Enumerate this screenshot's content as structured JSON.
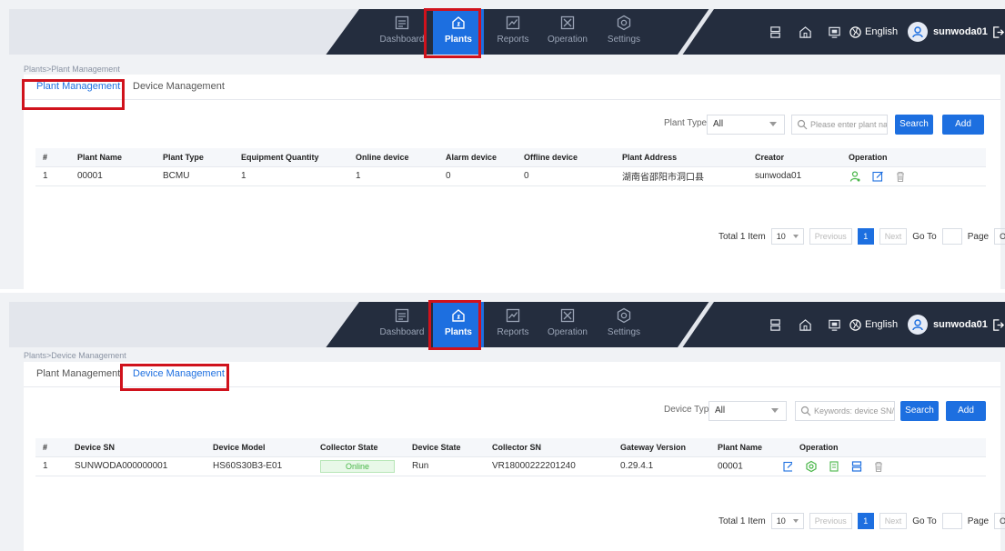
{
  "nav": {
    "items": [
      {
        "label": "Dashboard",
        "icon": "dashboard-icon"
      },
      {
        "label": "Plants",
        "icon": "plants-home-icon"
      },
      {
        "label": "Reports",
        "icon": "reports-icon"
      },
      {
        "label": "Operation",
        "icon": "operation-icon"
      },
      {
        "label": "Settings",
        "icon": "settings-icon"
      }
    ],
    "active_item": "Plants",
    "language": "English",
    "username": "sunwoda01",
    "accent_color": "#1d6fe0",
    "highlight_color": "#d0121c"
  },
  "panel1": {
    "breadcrumb": "Plants>Plant Management",
    "tabs": [
      "Plant Management",
      "Device Management"
    ],
    "active_tab": "Plant Management",
    "filter_label": "Plant Type:",
    "filter_value": "All",
    "search_placeholder": "Please enter plant name",
    "search_label": "Search",
    "add_label": "Add",
    "columns": [
      "#",
      "Plant Name",
      "Plant Type",
      "Equipment Quantity",
      "Online device",
      "Alarm device",
      "Offline device",
      "Plant Address",
      "Creator",
      "Operation"
    ],
    "rows": [
      {
        "num": "1",
        "plant_name": "00001",
        "plant_type": "BCMU",
        "equipment_quantity": "1",
        "online": "1",
        "alarm": "0",
        "offline": "0",
        "address": "湖南省邵阳市洞口县",
        "creator": "sunwoda01"
      }
    ],
    "pager": {
      "total": "Total 1 Item",
      "page_size": "10",
      "previous": "Previous",
      "current_page": "1",
      "next": "Next",
      "goto": "Go To",
      "page": "Page",
      "ok": "OK"
    }
  },
  "panel2": {
    "breadcrumb": "Plants>Device Management",
    "tabs": [
      "Plant Management",
      "Device Management"
    ],
    "active_tab": "Device Management",
    "filter_label": "Device Type:",
    "filter_value": "All",
    "search_placeholder": "Keywords: device SN/colle",
    "search_label": "Search",
    "add_label": "Add",
    "columns": [
      "#",
      "Device SN",
      "Device Model",
      "Collector State",
      "Device State",
      "Collector SN",
      "Gateway Version",
      "Plant Name",
      "Operation"
    ],
    "rows": [
      {
        "num": "1",
        "device_sn": "SUNWODA000000001",
        "device_model": "HS60S30B3-E01",
        "collector_state": "Online",
        "device_state": "Run",
        "collector_sn": "VR18000222201240",
        "gateway_version": "0.29.4.1",
        "plant_name": "00001"
      }
    ],
    "pager": {
      "total": "Total 1 Item",
      "page_size": "10",
      "previous": "Previous",
      "current_page": "1",
      "next": "Next",
      "goto": "Go To",
      "page": "Page",
      "ok": "OK"
    }
  }
}
